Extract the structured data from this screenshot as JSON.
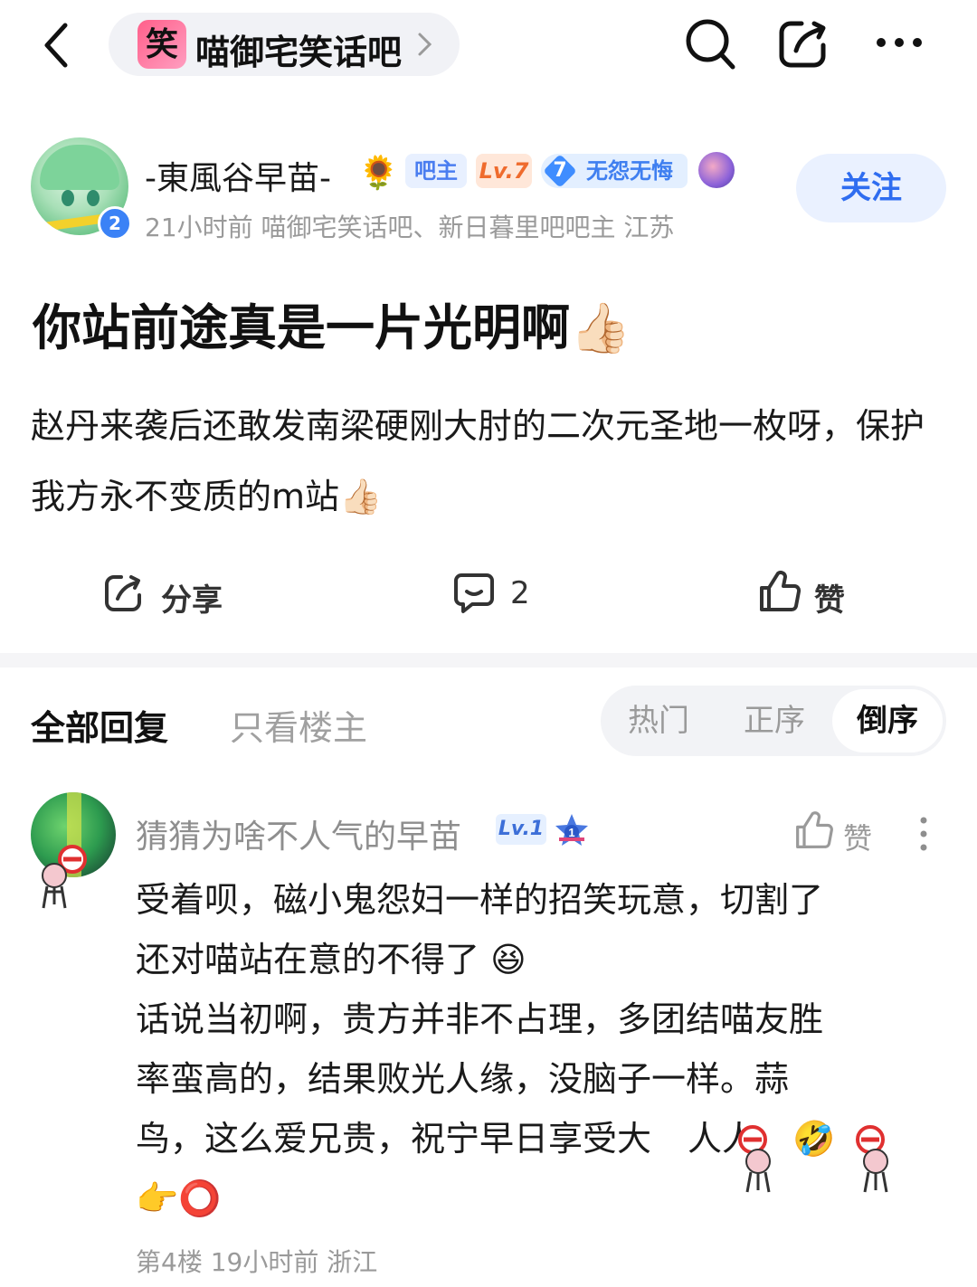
{
  "topbar": {
    "forum_logo_char": "笑",
    "forum_name": "喵御宅笑话吧"
  },
  "author": {
    "name": "-東風谷早苗-",
    "name_emoji": "🌻",
    "level_digit": "2",
    "tag_bazhu": "吧主",
    "tag_level": "Lv.7",
    "badge_num": "7",
    "badge_text": "无怨无悔",
    "meta": "21小时前   喵御宅笑话吧、新日暮里吧吧主 江苏",
    "follow_label": "关注"
  },
  "post": {
    "title": "你站前途真是一片光明啊",
    "title_emoji": "👍🏻",
    "body": "赵丹来袭后还敢发南梁硬刚大肘的二次元圣地一枚呀，保护我方永不变质的m站",
    "body_emoji": "👍🏻"
  },
  "actions": {
    "share_label": "分享",
    "comment_count": "2",
    "like_label": "赞"
  },
  "reply_tabs": {
    "all_label": "全部回复",
    "op_only_label": "只看楼主",
    "sort_hot": "热门",
    "sort_asc": "正序",
    "sort_desc": "倒序"
  },
  "reply": {
    "user_name": "猜猜为啥不人气的早苗",
    "level": "Lv.1",
    "star_digit": "1",
    "like_label": "赞",
    "line1": "受着呗，磁小鬼怨妇一样的招笑玩意，切割了",
    "line2": "还对喵站在意的不得了",
    "line2_emoji": "😆",
    "line3": "话说当初啊，贵方并非不占理，多团结喵友胜",
    "line4": "率蛮高的，结果败光人缘，没脑子一样。蒜",
    "line5": "鸟，这么爱兄贵，祝宁早日享受大",
    "line5_cont": "人人",
    "line5_emoji": "🤣",
    "line6_emoji": "👉",
    "line6_circle": "⭕",
    "meta": "第4楼 19小时前 浙江"
  },
  "colors": {
    "accent_blue": "#2f6df0",
    "follow_bg": "#eaf1ff",
    "muted_text": "#9a9a9a"
  }
}
